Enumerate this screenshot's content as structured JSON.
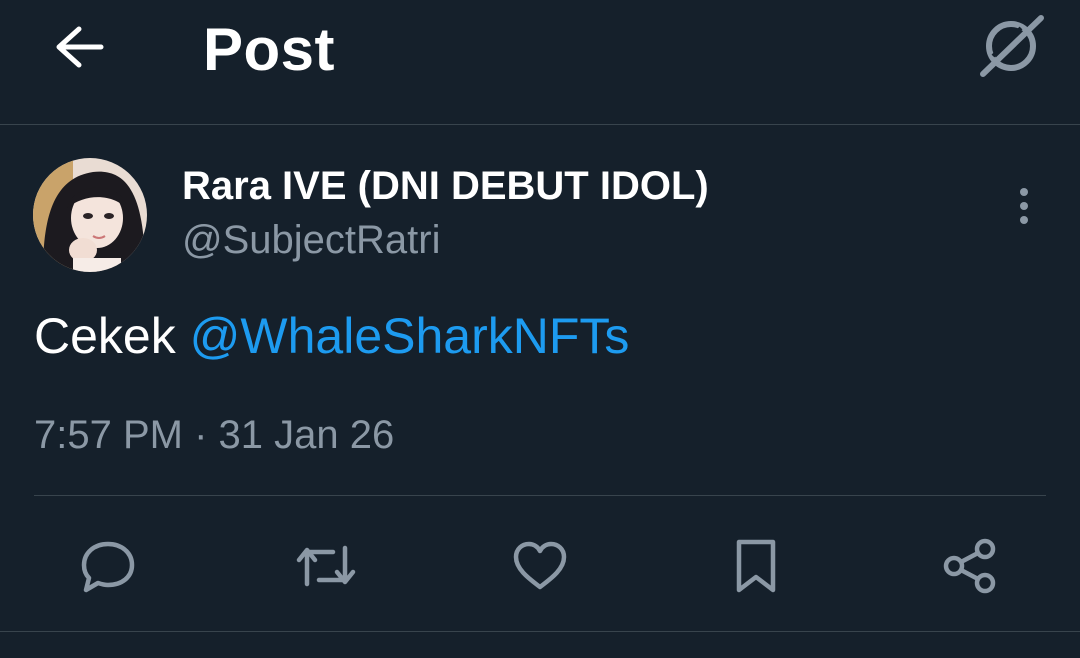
{
  "header": {
    "title": "Post",
    "back_icon": "arrow-left-icon",
    "grok_icon": "grok-icon"
  },
  "author": {
    "display_name": "Rara IVE (DNI DEBUT IDOL)",
    "handle": "@SubjectRatri",
    "avatar": "avatar-image",
    "more_icon": "more-vertical-icon"
  },
  "post": {
    "text_prefix": "Cekek",
    "mention": "@WhaleSharkNFTs",
    "time": "7:57 PM",
    "separator": "·",
    "date": "31 Jan 26"
  },
  "actions": [
    {
      "name": "reply",
      "icon": "reply-icon"
    },
    {
      "name": "repost",
      "icon": "repost-icon"
    },
    {
      "name": "like",
      "icon": "heart-icon"
    },
    {
      "name": "bookmark",
      "icon": "bookmark-icon"
    },
    {
      "name": "share",
      "icon": "share-icon"
    }
  ],
  "colors": {
    "background": "#15202b",
    "text_primary": "#ffffff",
    "text_secondary": "#8b98a5",
    "link": "#1d9bf0",
    "divider": "#38444d"
  }
}
